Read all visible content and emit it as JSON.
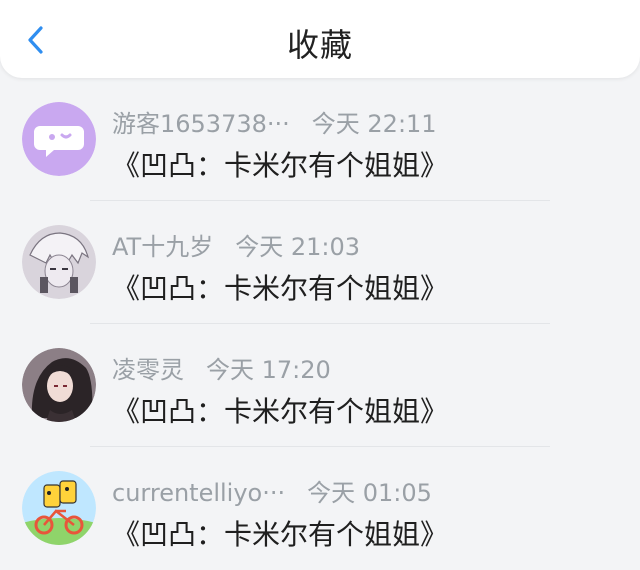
{
  "header": {
    "title": "收藏",
    "back_icon": "chevron-left-icon",
    "accent": "#2f8ef0"
  },
  "items": [
    {
      "name": "游客1653738···",
      "time": "今天 22:11",
      "book": "《凹凸：卡米尔有个姐姐》",
      "avatar_icon": "chat-bubble-avatar-icon",
      "avatar_color": "#c9a8f0"
    },
    {
      "name": "AT十九岁",
      "time": "今天 21:03",
      "book": "《凹凸：卡米尔有个姐姐》",
      "avatar_icon": "anime-character-avatar-icon",
      "avatar_color": "#d9d4dc"
    },
    {
      "name": "凌零灵",
      "time": "今天 17:20",
      "book": "《凹凸：卡米尔有个姐姐》",
      "avatar_icon": "dark-haired-character-avatar-icon",
      "avatar_color": "#6b5c63"
    },
    {
      "name": "currentelliyo···",
      "time": "今天 01:05",
      "book": "《凹凸：卡米尔有个姐姐》",
      "avatar_icon": "cartoon-bicycle-avatar-icon",
      "avatar_color": "#bfe7ff"
    }
  ]
}
